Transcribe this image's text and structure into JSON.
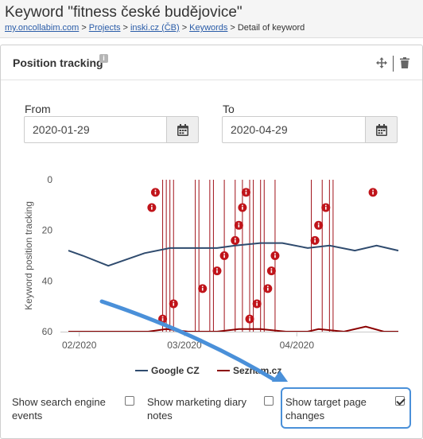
{
  "page": {
    "title": "Keyword \"fitness české budějovice\"",
    "breadcrumb": [
      {
        "label": "my.oncollabim.com",
        "link": true
      },
      {
        "label": "Projects",
        "link": true
      },
      {
        "label": "inski.cz (ČB)",
        "link": true
      },
      {
        "label": "Keywords",
        "link": true
      },
      {
        "label": "Detail of keyword",
        "link": false
      }
    ],
    "separator": ">"
  },
  "panel": {
    "title": "Position tracking",
    "info_badge": "i",
    "icons": {
      "move": "move-icon",
      "trash": "trash-icon",
      "calendar": "calendar-icon",
      "info": "info-icon"
    }
  },
  "date_range": {
    "from_label": "From",
    "from_value": "2020-01-29",
    "to_label": "To",
    "to_value": "2020-04-29"
  },
  "chart_data": {
    "type": "line",
    "ylabel": "Keyword position tracking",
    "y_reversed": true,
    "ylim": [
      0,
      60
    ],
    "yticks": [
      "0",
      "20",
      "40",
      "60"
    ],
    "xlim": [
      "2020-01-29",
      "2020-04-29"
    ],
    "xticks": [
      {
        "label": "02/2020",
        "date": "2020-02-01"
      },
      {
        "label": "03/2020",
        "date": "2020-03-01"
      },
      {
        "label": "04/2020",
        "date": "2020-04-01"
      }
    ],
    "grid": false,
    "legend_position": "bottom",
    "series": [
      {
        "name": "Google CZ",
        "color": "#2f4b6e",
        "points": [
          [
            "2020-01-29",
            28
          ],
          [
            "2020-02-02",
            30
          ],
          [
            "2020-02-09",
            34
          ],
          [
            "2020-02-19",
            29
          ],
          [
            "2020-02-26",
            27
          ],
          [
            "2020-03-04",
            27
          ],
          [
            "2020-03-10",
            27
          ],
          [
            "2020-03-15",
            26
          ],
          [
            "2020-03-22",
            25
          ],
          [
            "2020-03-28",
            25
          ],
          [
            "2020-04-04",
            27
          ],
          [
            "2020-04-10",
            26
          ],
          [
            "2020-04-17",
            28
          ],
          [
            "2020-04-23",
            26
          ],
          [
            "2020-04-29",
            28
          ]
        ]
      },
      {
        "name": "Seznam.cz",
        "color": "#8b0000",
        "points": [
          [
            "2020-01-29",
            60
          ],
          [
            "2020-02-20",
            60
          ],
          [
            "2020-02-25",
            59
          ],
          [
            "2020-03-02",
            60
          ],
          [
            "2020-03-10",
            60
          ],
          [
            "2020-03-16",
            59
          ],
          [
            "2020-03-22",
            59
          ],
          [
            "2020-03-29",
            60
          ],
          [
            "2020-04-04",
            60
          ],
          [
            "2020-04-07",
            59
          ],
          [
            "2020-04-14",
            60
          ],
          [
            "2020-04-20",
            58
          ],
          [
            "2020-04-25",
            60
          ],
          [
            "2020-04-29",
            60
          ]
        ]
      }
    ],
    "target_page_changes": [
      "2020-02-24",
      "2020-02-25",
      "2020-02-26",
      "2020-02-27",
      "2020-03-04",
      "2020-03-05",
      "2020-03-08",
      "2020-03-09",
      "2020-03-12",
      "2020-03-15",
      "2020-03-17",
      "2020-03-19",
      "2020-03-20",
      "2020-03-22",
      "2020-03-23",
      "2020-03-26",
      "2020-04-05",
      "2020-04-08",
      "2020-04-10",
      "2020-04-11"
    ],
    "info_markers": [
      {
        "date": "2020-02-22",
        "y": 5
      },
      {
        "date": "2020-02-21",
        "y": 11
      },
      {
        "date": "2020-02-24",
        "y": 55
      },
      {
        "date": "2020-02-27",
        "y": 49
      },
      {
        "date": "2020-03-06",
        "y": 43
      },
      {
        "date": "2020-03-10",
        "y": 36
      },
      {
        "date": "2020-03-12",
        "y": 30
      },
      {
        "date": "2020-03-15",
        "y": 24
      },
      {
        "date": "2020-03-16",
        "y": 18
      },
      {
        "date": "2020-03-17",
        "y": 11
      },
      {
        "date": "2020-03-18",
        "y": 5
      },
      {
        "date": "2020-03-19",
        "y": 55
      },
      {
        "date": "2020-03-21",
        "y": 49
      },
      {
        "date": "2020-03-24",
        "y": 43
      },
      {
        "date": "2020-03-25",
        "y": 36
      },
      {
        "date": "2020-03-26",
        "y": 30
      },
      {
        "date": "2020-04-06",
        "y": 24
      },
      {
        "date": "2020-04-07",
        "y": 18
      },
      {
        "date": "2020-04-09",
        "y": 11
      },
      {
        "date": "2020-04-22",
        "y": 5
      }
    ],
    "marker_color": "#c0141a",
    "annotation_arrow_color": "#4a90d9"
  },
  "options": [
    {
      "label": "Show search engine events",
      "checked": false
    },
    {
      "label": "Show marketing diary notes",
      "checked": false
    },
    {
      "label": "Show target page changes",
      "checked": true
    }
  ]
}
